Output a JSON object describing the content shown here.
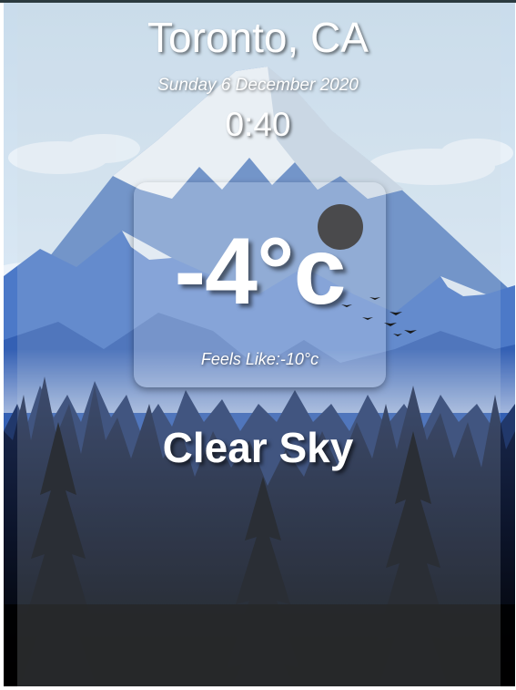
{
  "location": {
    "city_label": "Toronto, CA"
  },
  "datetime": {
    "date_label": "Sunday 6 December 2020",
    "time_label": "0:40"
  },
  "weather": {
    "temperature_label": "-4°c",
    "feels_like_label": "Feels Like:-10°c",
    "description_label": "Clear Sky",
    "icon": "moon-icon"
  },
  "colors": {
    "moon": "#4a4a4c",
    "sky_top": "#cfe4f4",
    "mountain_blue": "#3f6fc0",
    "forest_dark": "#0f1a33",
    "text": "#ffffff"
  }
}
